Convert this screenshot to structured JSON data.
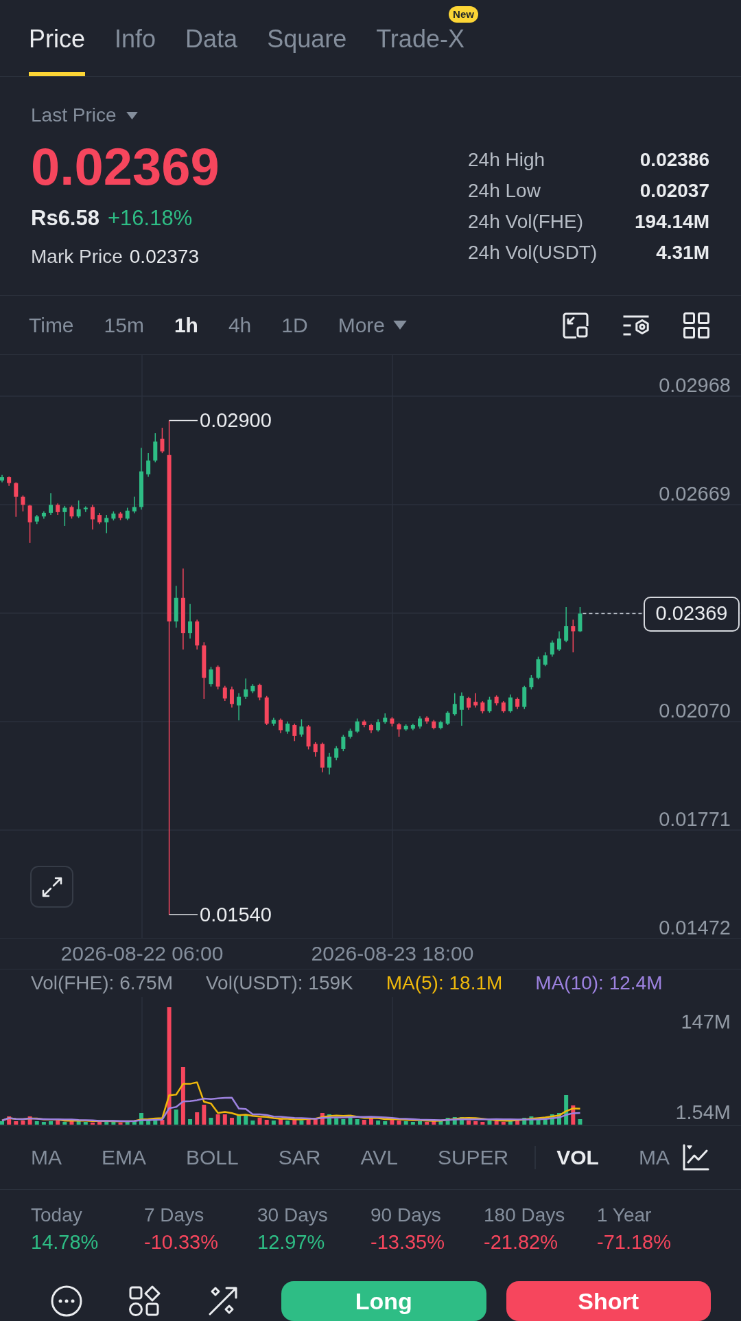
{
  "tabs": [
    {
      "label": "Price",
      "selected": true
    },
    {
      "label": "Info",
      "selected": false
    },
    {
      "label": "Data",
      "selected": false
    },
    {
      "label": "Square",
      "selected": false
    },
    {
      "label": "Trade-X",
      "selected": false,
      "badge": "New"
    }
  ],
  "price_header": {
    "price_type": "Last Price",
    "last_price": "0.02369",
    "fiat_price": "Rs6.58",
    "change": "+16.18%",
    "mark_price_label": "Mark Price",
    "mark_price": "0.02373",
    "stats": [
      {
        "label": "24h High",
        "value": "0.02386"
      },
      {
        "label": "24h Low",
        "value": "0.02037"
      },
      {
        "label": "24h Vol(FHE)",
        "value": "194.14M"
      },
      {
        "label": "24h Vol(USDT)",
        "value": "4.31M"
      }
    ]
  },
  "timeframes": [
    {
      "label": "Time",
      "selected": false
    },
    {
      "label": "15m",
      "selected": false
    },
    {
      "label": "1h",
      "selected": true
    },
    {
      "label": "4h",
      "selected": false
    },
    {
      "label": "1D",
      "selected": false
    }
  ],
  "more": "More",
  "price_chart": {
    "price_axis": [
      "0.02968",
      "0.02669",
      "0.02070",
      "0.01771",
      "0.01472"
    ],
    "high_marker": "0.02900",
    "low_marker": "0.01540",
    "current_price": "0.02369",
    "time_axis": [
      "2026-08-22 06:00",
      "2026-08-23 18:00"
    ]
  },
  "volume_chart": {
    "legend": [
      {
        "label": "Vol(FHE): 6.75M",
        "kind": "plain"
      },
      {
        "label": "Vol(USDT): 159K",
        "kind": "plain"
      },
      {
        "label": "MA(5): 18.1M",
        "kind": "ma",
        "color": "#f0b90b"
      },
      {
        "label": "MA(10): 12.4M",
        "kind": "ma",
        "color": "#9d82e0"
      }
    ],
    "axis": [
      "147M",
      "1.54M"
    ]
  },
  "indicators": {
    "main": [
      {
        "label": "MA",
        "selected": false
      },
      {
        "label": "EMA",
        "selected": false
      },
      {
        "label": "BOLL",
        "selected": false
      },
      {
        "label": "SAR",
        "selected": false
      },
      {
        "label": "AVL",
        "selected": false
      },
      {
        "label": "SUPER",
        "selected": false
      }
    ],
    "sub": [
      {
        "label": "VOL",
        "selected": true
      },
      {
        "label": "MA",
        "selected": false
      }
    ]
  },
  "returns": [
    {
      "period": "Today",
      "value": "14.78%",
      "positive": true
    },
    {
      "period": "7 Days",
      "value": "-10.33%",
      "positive": false
    },
    {
      "period": "30 Days",
      "value": "12.97%",
      "positive": true
    },
    {
      "period": "90 Days",
      "value": "-13.35%",
      "positive": false
    },
    {
      "period": "180 Days",
      "value": "-21.82%",
      "positive": false
    },
    {
      "period": "1 Year",
      "value": "-71.18%",
      "positive": false
    }
  ],
  "actions": {
    "long": "Long",
    "short": "Short"
  }
}
